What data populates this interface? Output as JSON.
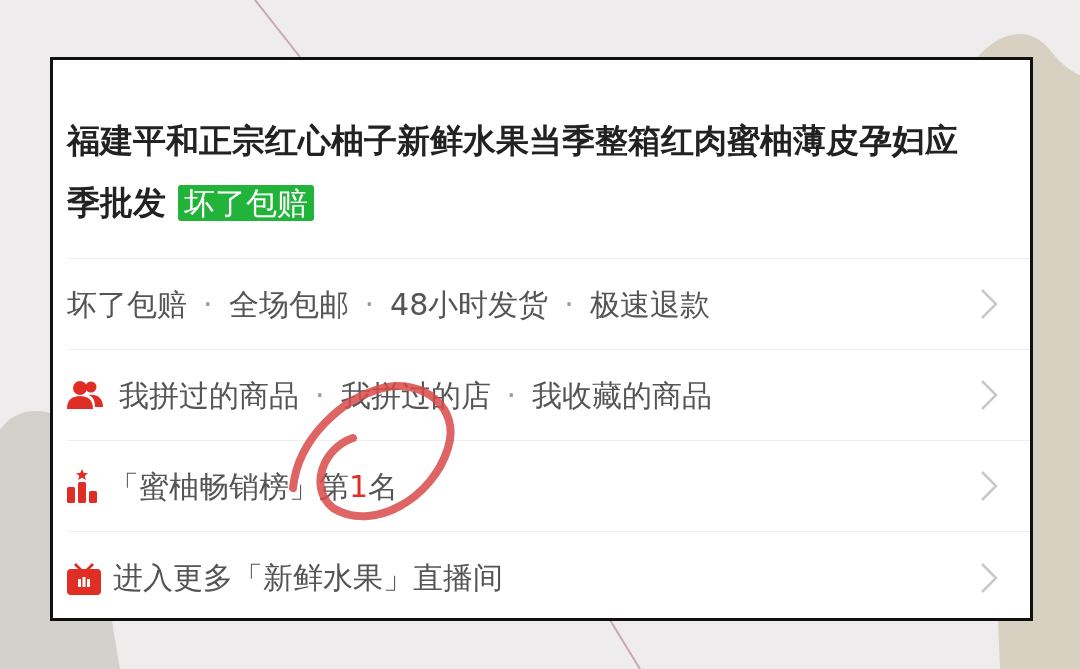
{
  "product": {
    "title": "福建平和正宗红心柚子新鲜水果当季整箱红肉蜜柚薄皮孕妇应季批发",
    "badge": "坏了包赔"
  },
  "rows": [
    {
      "kind": "services",
      "separator": "·",
      "items": [
        "坏了包赔",
        "全场包邮",
        "48小时发货",
        "极速退款"
      ]
    },
    {
      "kind": "history",
      "separator": "·",
      "items": [
        "我拼过的商品",
        "我拼过的店",
        "我收藏的商品"
      ]
    },
    {
      "kind": "ranking",
      "prefix": "「蜜柚畅销榜」第",
      "rank": "1",
      "suffix": "名"
    },
    {
      "kind": "live",
      "text": "进入更多「新鲜水果」直播间"
    }
  ]
}
